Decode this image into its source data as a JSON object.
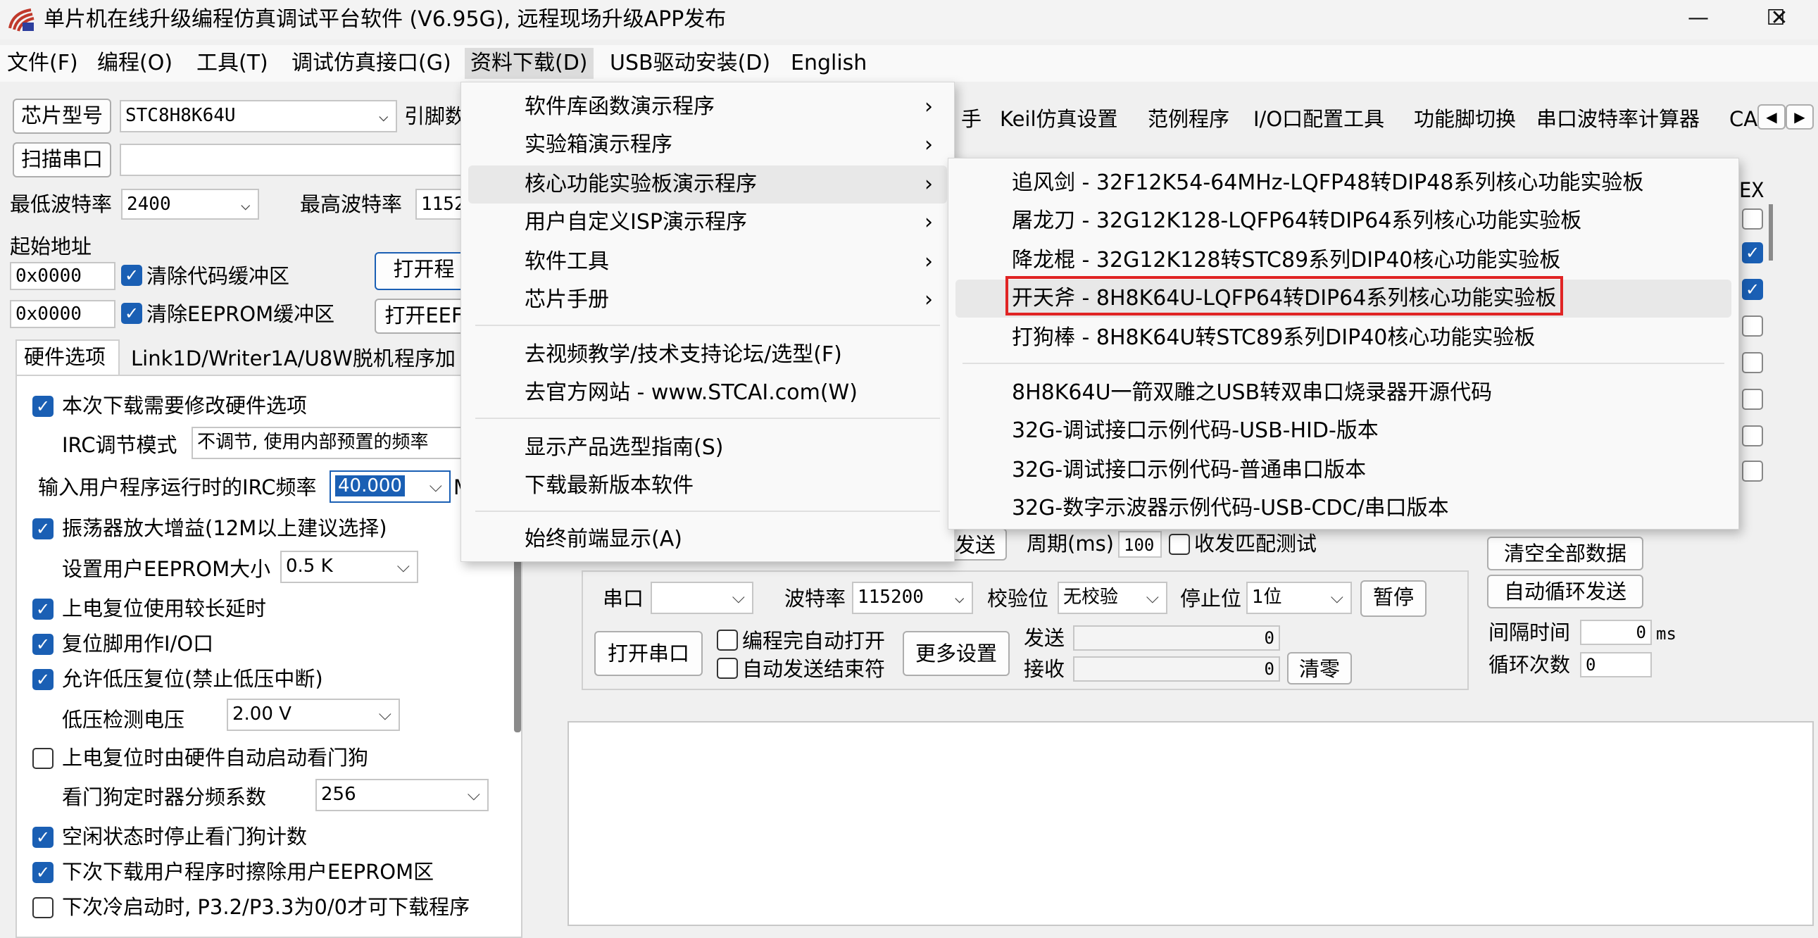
{
  "window": {
    "title": "单片机在线升级编程仿真调试平台软件 (V6.95G), 远程现场升级APP发布",
    "min_glyph": "—",
    "max_glyph": "☐",
    "close_glyph": "✕"
  },
  "menubar": [
    "文件(F)",
    "编程(O)",
    "工具(T)",
    "调试仿真接口(G)",
    "资料下载(D)",
    "USB驱动安装(D)",
    "English"
  ],
  "left": {
    "chip_type_btn": "芯片型号",
    "chip_type_value": "STC8H8K64U",
    "pin_label": "引脚数",
    "scan_port_btn": "扫描串口",
    "scan_port_value": "",
    "min_baud_label": "最低波特率",
    "min_baud_value": "2400",
    "max_baud_label": "最高波特率",
    "max_baud_value": "1152",
    "start_addr_label": "起始地址",
    "addr1": "0x0000",
    "clear_code_label": "清除代码缓冲区",
    "open_prog_btn": "打开程",
    "addr2": "0x0000",
    "clear_eeprom_label": "清除EEPROM缓冲区",
    "open_eeprom_btn": "打开EEF",
    "tabs": [
      "硬件选项",
      "Link1D/Writer1A/U8W脱机",
      "程序加"
    ],
    "options": {
      "modify_hw": "本次下载需要修改硬件选项",
      "irc_mode_label": "IRC调节模式",
      "irc_mode_value": "不调节, 使用内部预置的频率",
      "irc_freq_label": "输入用户程序运行时的IRC频率",
      "irc_freq_value": "40.000",
      "irc_unit": "M",
      "osc_gain": "振荡器放大增益(12M以上建议选择)",
      "eeprom_size_label": "设置用户EEPROM大小",
      "eeprom_size_value": "0.5 K",
      "power_delay": "上电复位使用较长延时",
      "reset_io": "复位脚用作I/O口",
      "low_volt_reset": "允许低压复位(禁止低压中断)",
      "low_volt_label": "低压检测电压",
      "low_volt_value": "2.00 V",
      "wdt_auto": "上电复位时由硬件自动启动看门狗",
      "wdt_div_label": "看门狗定时器分频系数",
      "wdt_div_value": "256",
      "idle_wdt": "空闲状态时停止看门狗计数",
      "erase_eeprom": "下次下载用户程序时擦除用户EEPROM区",
      "p32_p33": "下次冷启动时, P3.2/P3.3为0/0才可下载程序"
    }
  },
  "right": {
    "tabs": [
      "手",
      "Keil仿真设置",
      "范例程序",
      "I/O口配置工具",
      "功能脚切换",
      "串口波特率计算器",
      "CA"
    ],
    "tab_arrows": [
      "◀",
      "▶"
    ],
    "hex_label": "EX",
    "send_btn_partial": "发送",
    "period_label": "周期(ms)",
    "period_value": "100",
    "match_test_label": "收发匹配测试",
    "clear_all_btn": "清空全部数据",
    "auto_loop_btn": "自动循环发送",
    "port_label": "串口",
    "port_value": "",
    "baud_label": "波特率",
    "baud_value": "115200",
    "parity_label": "校验位",
    "parity_value": "无校验",
    "stop_label": "停止位",
    "stop_value": "1位",
    "pause_btn": "暂停",
    "open_port_btn": "打开串口",
    "auto_open_label": "编程完自动打开",
    "auto_end_label": "自动发送结束符",
    "more_settings_btn": "更多设置",
    "send_label": "发送",
    "send_count": "0",
    "recv_label": "接收",
    "recv_count": "0",
    "clear_zero_btn": "清零",
    "interval_label": "间隔时间",
    "interval_value": "0",
    "interval_unit": "ms",
    "loop_count_label": "循环次数",
    "loop_count_value": "0"
  },
  "dropdown": {
    "items": [
      {
        "label": "软件库函数演示程序",
        "submenu": true
      },
      {
        "label": "实验箱演示程序",
        "submenu": true
      },
      {
        "label": "核心功能实验板演示程序",
        "submenu": true
      },
      {
        "label": "用户自定义ISP演示程序",
        "submenu": true
      },
      {
        "label": "软件工具",
        "submenu": true
      },
      {
        "label": "芯片手册",
        "submenu": true
      },
      {
        "label": "去视频教学/技术支持论坛/选型(F)",
        "submenu": false
      },
      {
        "label": "去官方网站 - www.STCAI.com(W)",
        "submenu": false
      },
      {
        "label": "显示产品选型指南(S)",
        "submenu": false
      },
      {
        "label": "下载最新版本软件",
        "submenu": false
      },
      {
        "label": "始终前端显示(A)",
        "submenu": false
      }
    ],
    "arrow": "›"
  },
  "submenu": {
    "items": [
      "追风剑 - 32F12K54-64MHz-LQFP48转DIP48系列核心功能实验板",
      "屠龙刀 - 32G12K128-LQFP64转DIP64系列核心功能实验板",
      "降龙棍 - 32G12K128转STC89系列DIP40核心功能实验板",
      "开天斧 - 8H8K64U-LQFP64转DIP64系列核心功能实验板",
      "打狗棒 - 8H8K64U转STC89系列DIP40核心功能实验板",
      "8H8K64U一箭双雕之USB转双串口烧录器开源代码",
      "32G-调试接口示例代码-USB-HID-版本",
      "32G-调试接口示例代码-普通串口版本",
      "32G-数字示波器示例代码-USB-CDC/串口版本"
    ]
  },
  "colors": {
    "accent": "#1a5fb4",
    "highlight_box": "#e02424",
    "logo": "#c0392b"
  }
}
